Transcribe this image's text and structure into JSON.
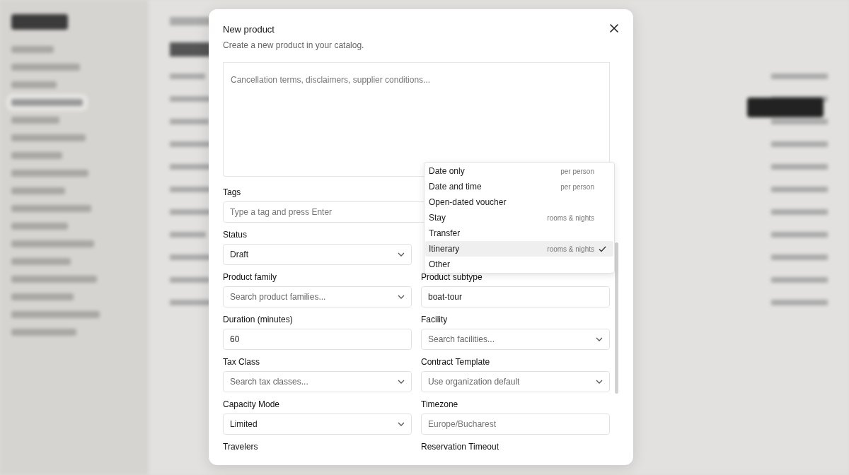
{
  "dialog": {
    "title": "New product",
    "subtitle": "Create a new product in your catalog."
  },
  "notes_field": {
    "placeholder": "Cancellation terms, disclaimers, supplier conditions..."
  },
  "field_rows": [
    [
      {
        "label": "Tags",
        "kind": "text",
        "wide": true,
        "placeholder": "Type a tag and press Enter"
      }
    ],
    [
      {
        "label": "Status",
        "kind": "select",
        "value": "Draft"
      }
    ],
    [
      {
        "label": "Product family",
        "kind": "select",
        "placeholder": "Search product families..."
      },
      {
        "label": "Product subtype",
        "kind": "text",
        "value": "boat-tour"
      }
    ],
    [
      {
        "label": "Duration (minutes)",
        "kind": "text",
        "value": "60"
      },
      {
        "label": "Facility",
        "kind": "select",
        "placeholder": "Search facilities..."
      }
    ],
    [
      {
        "label": "Tax Class",
        "kind": "select",
        "placeholder": "Search tax classes..."
      },
      {
        "label": "Contract Template",
        "kind": "select",
        "placeholder": "Use organization default"
      }
    ],
    [
      {
        "label": "Capacity Mode",
        "kind": "select",
        "value": "Limited"
      },
      {
        "label": "Timezone",
        "kind": "text",
        "placeholder": "Europe/Bucharest"
      }
    ],
    [
      {
        "label": "Travelers",
        "kind": "label"
      },
      {
        "label": "Reservation Timeout",
        "kind": "label"
      }
    ]
  ],
  "dropdown_options": [
    {
      "label": "Date only",
      "note": "per person",
      "selected": false
    },
    {
      "label": "Date and time",
      "note": "per person",
      "selected": false
    },
    {
      "label": "Open-dated voucher",
      "selected": false
    },
    {
      "label": "Stay",
      "note": "rooms & nights",
      "selected": false
    },
    {
      "label": "Transfer",
      "selected": false
    },
    {
      "label": "Itinerary",
      "note": "rooms & nights",
      "selected": true
    },
    {
      "label": "Other",
      "selected": false
    }
  ]
}
